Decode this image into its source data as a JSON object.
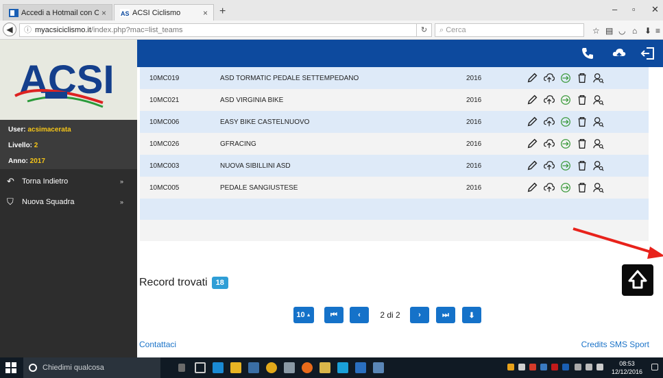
{
  "browser": {
    "tabs": [
      {
        "label": "Accedi a Hotmail con Out...",
        "active": false
      },
      {
        "label": "ACSI Ciclismo",
        "active": true
      }
    ],
    "url_host": "myacsiciclismo.it",
    "url_path": "/index.php?mac=list_teams",
    "search_placeholder": "Cerca"
  },
  "sidebar": {
    "user_label": "User:",
    "user_value": "acsimacerata",
    "level_label": "Livello:",
    "level_value": "2",
    "year_label": "Anno:",
    "year_value": "2017",
    "links": [
      {
        "label": "Torna Indietro",
        "icon": "back-arrow-icon"
      },
      {
        "label": "Nuova Squadra",
        "icon": "team-shirt-icon"
      }
    ]
  },
  "teams": [
    {
      "code": "10MC019",
      "name": "ASD TORMATIC PEDALE SETTEMPEDANO",
      "year": "2016"
    },
    {
      "code": "10MC021",
      "name": "ASD VIRGINIA BIKE",
      "year": "2016"
    },
    {
      "code": "10MC006",
      "name": "EASY BIKE CASTELNUOVO",
      "year": "2016"
    },
    {
      "code": "10MC026",
      "name": "GFRACING",
      "year": "2016"
    },
    {
      "code": "10MC003",
      "name": "NUOVA SIBILLINI ASD",
      "year": "2016"
    },
    {
      "code": "10MC005",
      "name": "PEDALE SANGIUSTESE",
      "year": "2016"
    }
  ],
  "row_actions": [
    "edit-pencil-icon",
    "cloud-upload-icon",
    "login-arrow-icon",
    "trash-icon",
    "user-search-icon"
  ],
  "records": {
    "label": "Record trovati",
    "count": "18"
  },
  "pagination": {
    "page_size": "10",
    "page_info": "2 di 2"
  },
  "footer": {
    "contact": "Contattaci",
    "credits": "Credits SMS Sport"
  },
  "taskbar": {
    "search_placeholder": "Chiedimi qualcosa",
    "time": "08:53",
    "date": "12/12/2016"
  },
  "colors": {
    "header_blue": "#0d4a9e",
    "row_blue": "#deeaf8",
    "pager_blue": "#1572c9",
    "badge_blue": "#2f9ed6",
    "accent_yellow": "#f5c518",
    "annotation_red": "#e8221b"
  }
}
